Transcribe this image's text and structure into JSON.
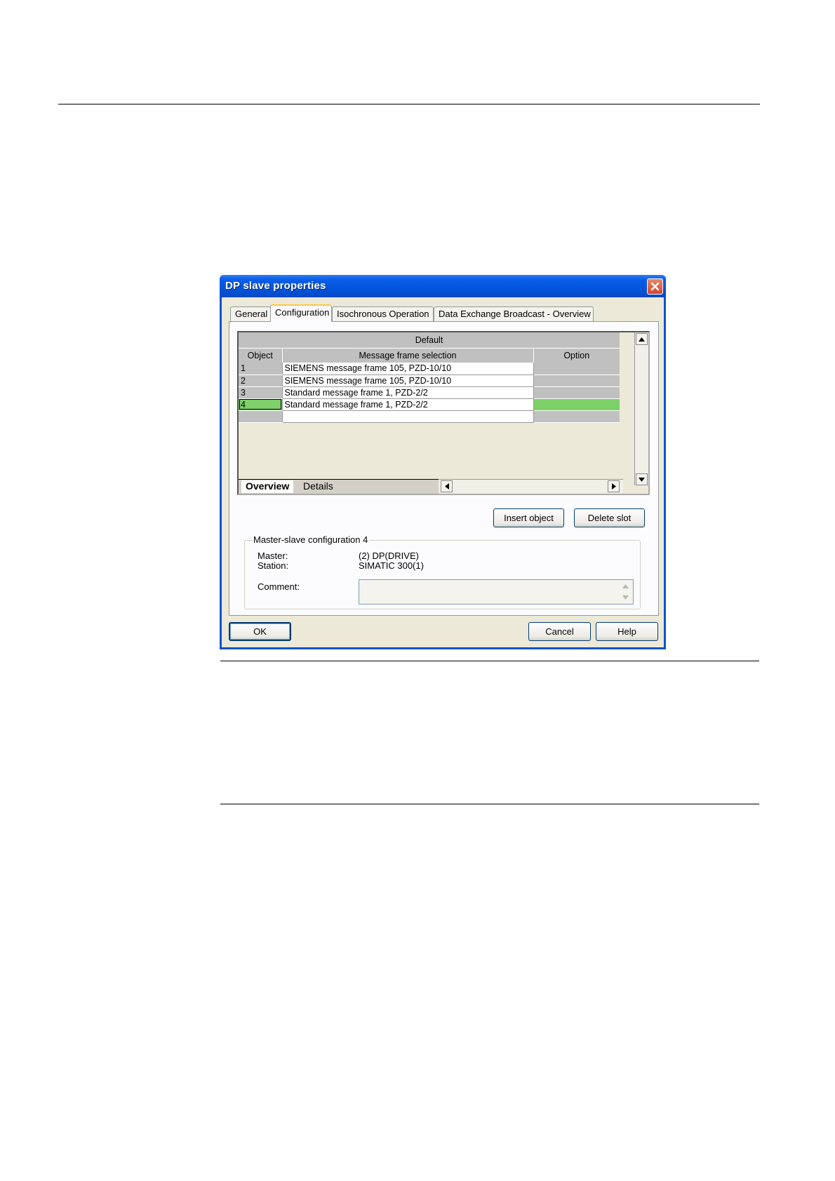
{
  "dialog": {
    "title": "DP slave properties",
    "tabs": [
      {
        "label": "General"
      },
      {
        "label": "Configuration"
      },
      {
        "label": "Isochronous Operation"
      },
      {
        "label": "Data Exchange Broadcast - Overview"
      }
    ],
    "active_tab": "Configuration"
  },
  "grid": {
    "group_header": "Default",
    "columns": {
      "object": "Object",
      "message": "Message frame selection",
      "option": "Option"
    },
    "rows": [
      {
        "object": "1",
        "message": "SIEMENS message frame 105, PZD-10/10",
        "option": ""
      },
      {
        "object": "2",
        "message": "SIEMENS message frame 105, PZD-10/10",
        "option": ""
      },
      {
        "object": "3",
        "message": "Standard message frame 1, PZD-2/2",
        "option": ""
      },
      {
        "object": "4",
        "message": "Standard message frame 1, PZD-2/2",
        "option": ""
      },
      {
        "object": "",
        "message": "",
        "option": ""
      }
    ],
    "selected_row_index": 3,
    "selection_color": "#7ed069",
    "sheet_tabs": [
      "Overview",
      "Details"
    ]
  },
  "buttons": {
    "insert_object": "Insert object",
    "delete_slot": "Delete slot",
    "ok": "OK",
    "cancel": "Cancel",
    "help": "Help"
  },
  "master_slave": {
    "group_title": "Master-slave configuration 4",
    "master_label": "Master:",
    "master_value": "(2) DP(DRIVE)",
    "station_label": "Station:",
    "station_value": "SIMATIC 300(1)",
    "comment_label": "Comment:",
    "comment_value": ""
  },
  "colors": {
    "titlebar": "#0052d6",
    "dialog_bg": "#ece9d8",
    "close_button": "#d4452b"
  }
}
